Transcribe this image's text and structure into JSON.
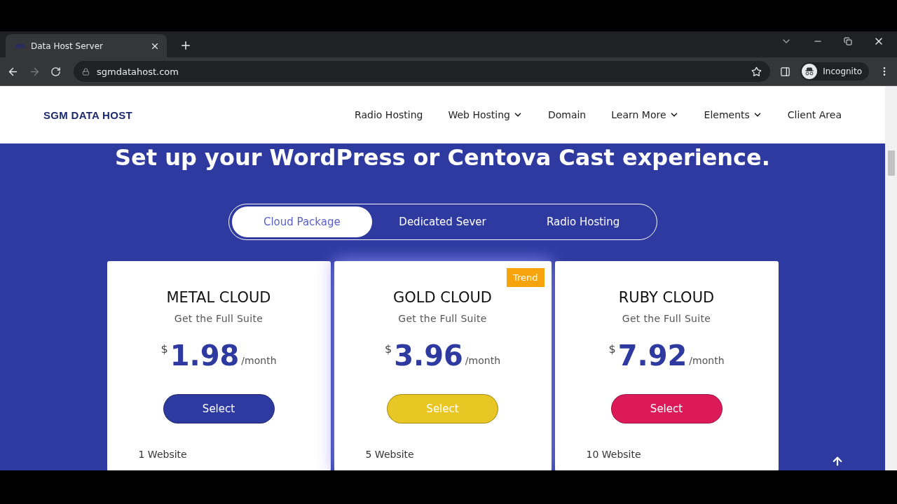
{
  "browser": {
    "tab_title": "Data Host Server",
    "url": "sgmdatahost.com",
    "profile": "Incognito"
  },
  "nav": {
    "logo": "SGM DATA HOST",
    "items": [
      {
        "label": "Radio Hosting",
        "dropdown": false
      },
      {
        "label": "Web Hosting",
        "dropdown": true
      },
      {
        "label": "Domain",
        "dropdown": false
      },
      {
        "label": "Learn More",
        "dropdown": true
      },
      {
        "label": "Elements",
        "dropdown": true
      },
      {
        "label": "Client Area",
        "dropdown": false
      }
    ]
  },
  "heading": "Set up your WordPress or Centova Cast experience.",
  "package_tabs": [
    {
      "label": "Cloud Package",
      "selected": true
    },
    {
      "label": "Dedicated Sever",
      "selected": false
    },
    {
      "label": "Radio Hosting",
      "selected": false
    }
  ],
  "plans": [
    {
      "name": "METAL CLOUD",
      "subtitle": "Get the Full Suite",
      "currency": "$",
      "price": "1.98",
      "period": "/month",
      "button": "Select",
      "color": "#2e3a9f",
      "featured": false,
      "features": [
        "1 Website"
      ]
    },
    {
      "name": "GOLD CLOUD",
      "subtitle": "Get the Full Suite",
      "currency": "$",
      "price": "3.96",
      "period": "/month",
      "button": "Select",
      "color": "#e8c724",
      "badge": "Trend",
      "featured": true,
      "features": [
        "5 Website"
      ]
    },
    {
      "name": "RUBY CLOUD",
      "subtitle": "Get the Full Suite",
      "currency": "$",
      "price": "7.92",
      "period": "/month",
      "button": "Select",
      "color": "#dc1a5a",
      "featured": false,
      "features": [
        "10 Website"
      ]
    }
  ]
}
